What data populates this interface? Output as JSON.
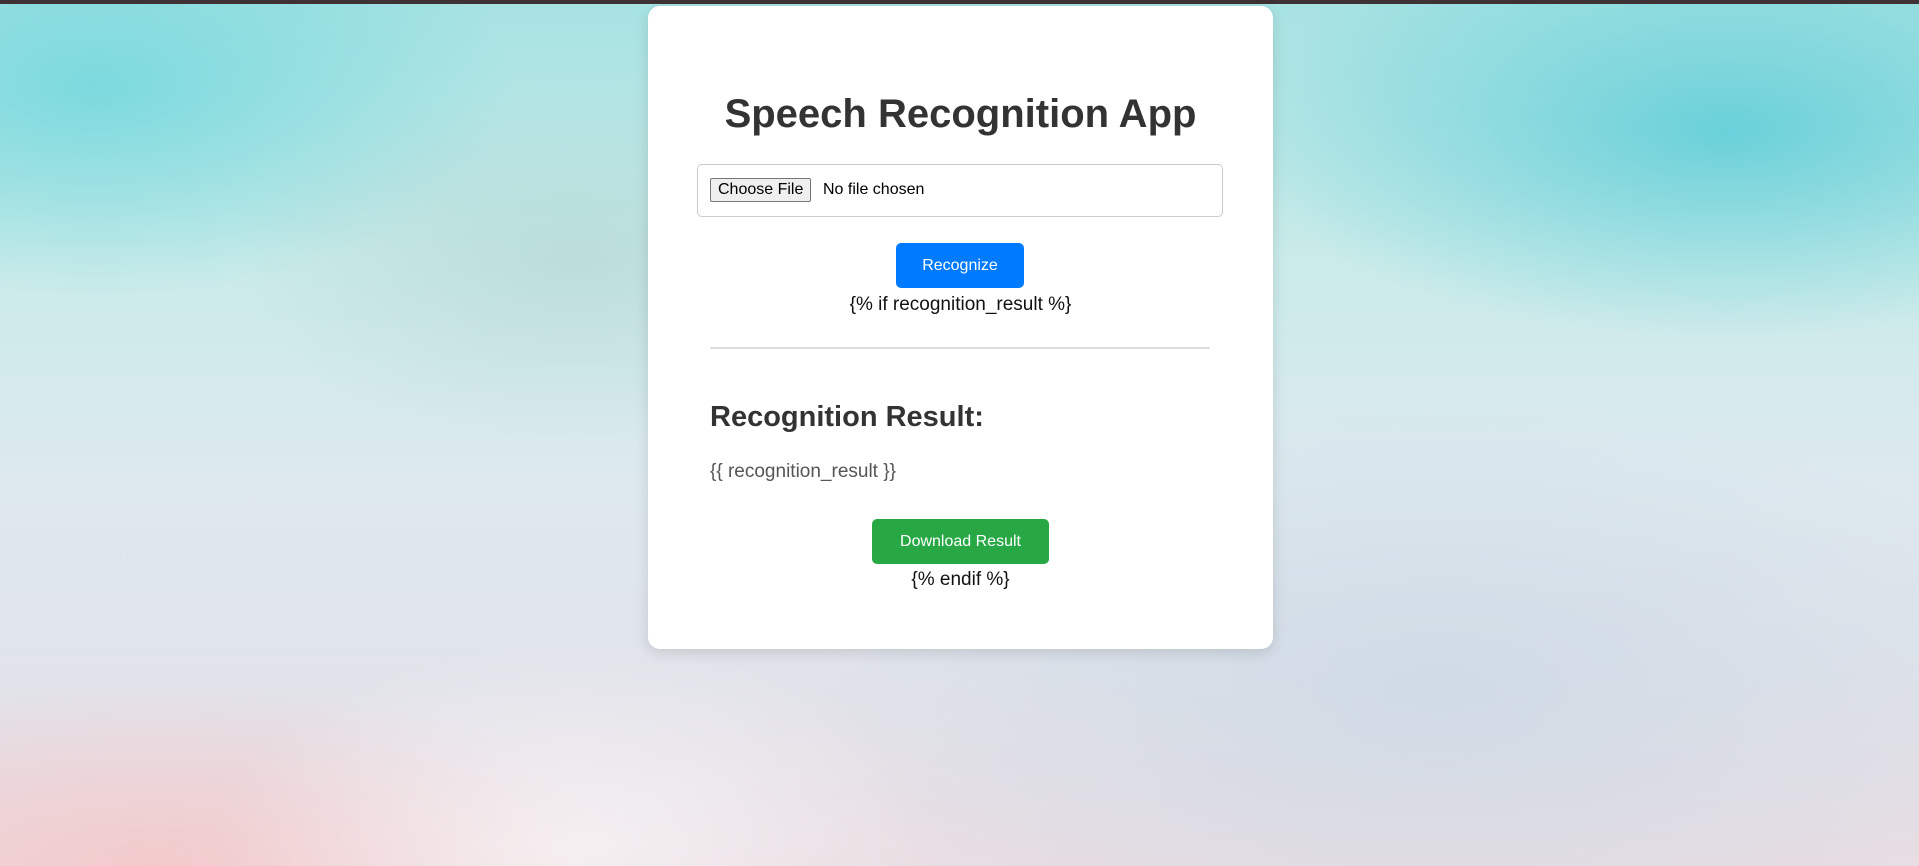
{
  "app": {
    "title": "Speech Recognition App"
  },
  "upload": {
    "choose_label": "Choose File",
    "status": "No file chosen"
  },
  "actions": {
    "recognize_label": "Recognize",
    "download_label": "Download Result"
  },
  "template_tags": {
    "if_tag": "{% if recognition_result %}",
    "endif_tag": "{% endif %}"
  },
  "result": {
    "heading": "Recognition Result:",
    "value": "{{ recognition_result }}"
  },
  "colors": {
    "primary": "#007bff",
    "success": "#28a745",
    "title_text": "#333333"
  }
}
